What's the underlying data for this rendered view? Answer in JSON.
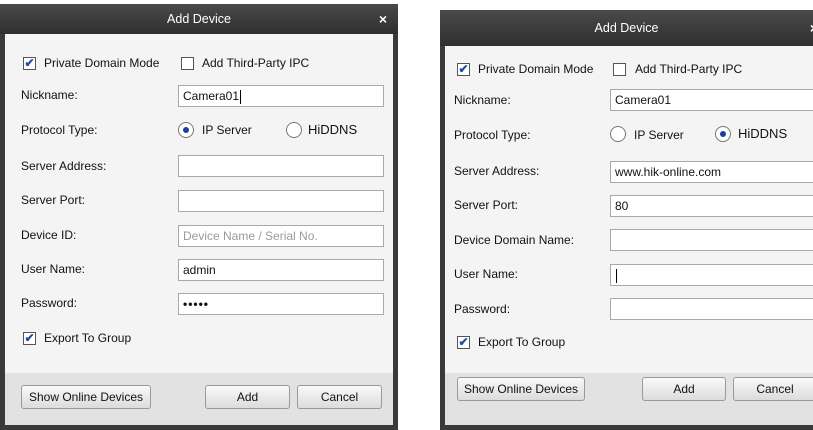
{
  "dialog_left": {
    "title": "Add Device",
    "close_glyph": "×",
    "private_domain_mode": {
      "label": "Private Domain Mode",
      "checked": true
    },
    "add_third_party_ipc": {
      "label": "Add Third-Party IPC",
      "checked": false
    },
    "nickname": {
      "label": "Nickname:",
      "value": "Camera01"
    },
    "protocol": {
      "label": "Protocol Type:",
      "options": [
        "IP Server",
        "HiDDNS"
      ],
      "selected": "IP Server"
    },
    "server_address": {
      "label": "Server Address:",
      "value": ""
    },
    "server_port": {
      "label": "Server Port:",
      "value": ""
    },
    "device_id": {
      "label": "Device ID:",
      "placeholder": "Device Name / Serial No."
    },
    "user_name": {
      "label": "User Name:",
      "value": "admin"
    },
    "password": {
      "label": "Password:",
      "value": "•••••"
    },
    "export_to_group": {
      "label": "Export To Group",
      "checked": true
    },
    "buttons": {
      "show_online": "Show Online Devices",
      "add": "Add",
      "cancel": "Cancel"
    }
  },
  "dialog_right": {
    "title": "Add Device",
    "close_glyph": "×",
    "private_domain_mode": {
      "label": "Private Domain Mode",
      "checked": true
    },
    "add_third_party_ipc": {
      "label": "Add Third-Party IPC",
      "checked": false
    },
    "nickname": {
      "label": "Nickname:",
      "value": "Camera01"
    },
    "protocol": {
      "label": "Protocol Type:",
      "options": [
        "IP Server",
        "HiDDNS"
      ],
      "selected": "HiDDNS"
    },
    "server_address": {
      "label": "Server Address:",
      "value": "www.hik-online.com"
    },
    "server_port": {
      "label": "Server Port:",
      "value": "80"
    },
    "device_domain_name": {
      "label": "Device Domain Name:",
      "value": ""
    },
    "user_name": {
      "label": "User Name:",
      "value": ""
    },
    "password": {
      "label": "Password:",
      "value": ""
    },
    "export_to_group": {
      "label": "Export To Group",
      "checked": true
    },
    "buttons": {
      "show_online": "Show Online Devices",
      "add": "Add",
      "cancel": "Cancel"
    }
  }
}
